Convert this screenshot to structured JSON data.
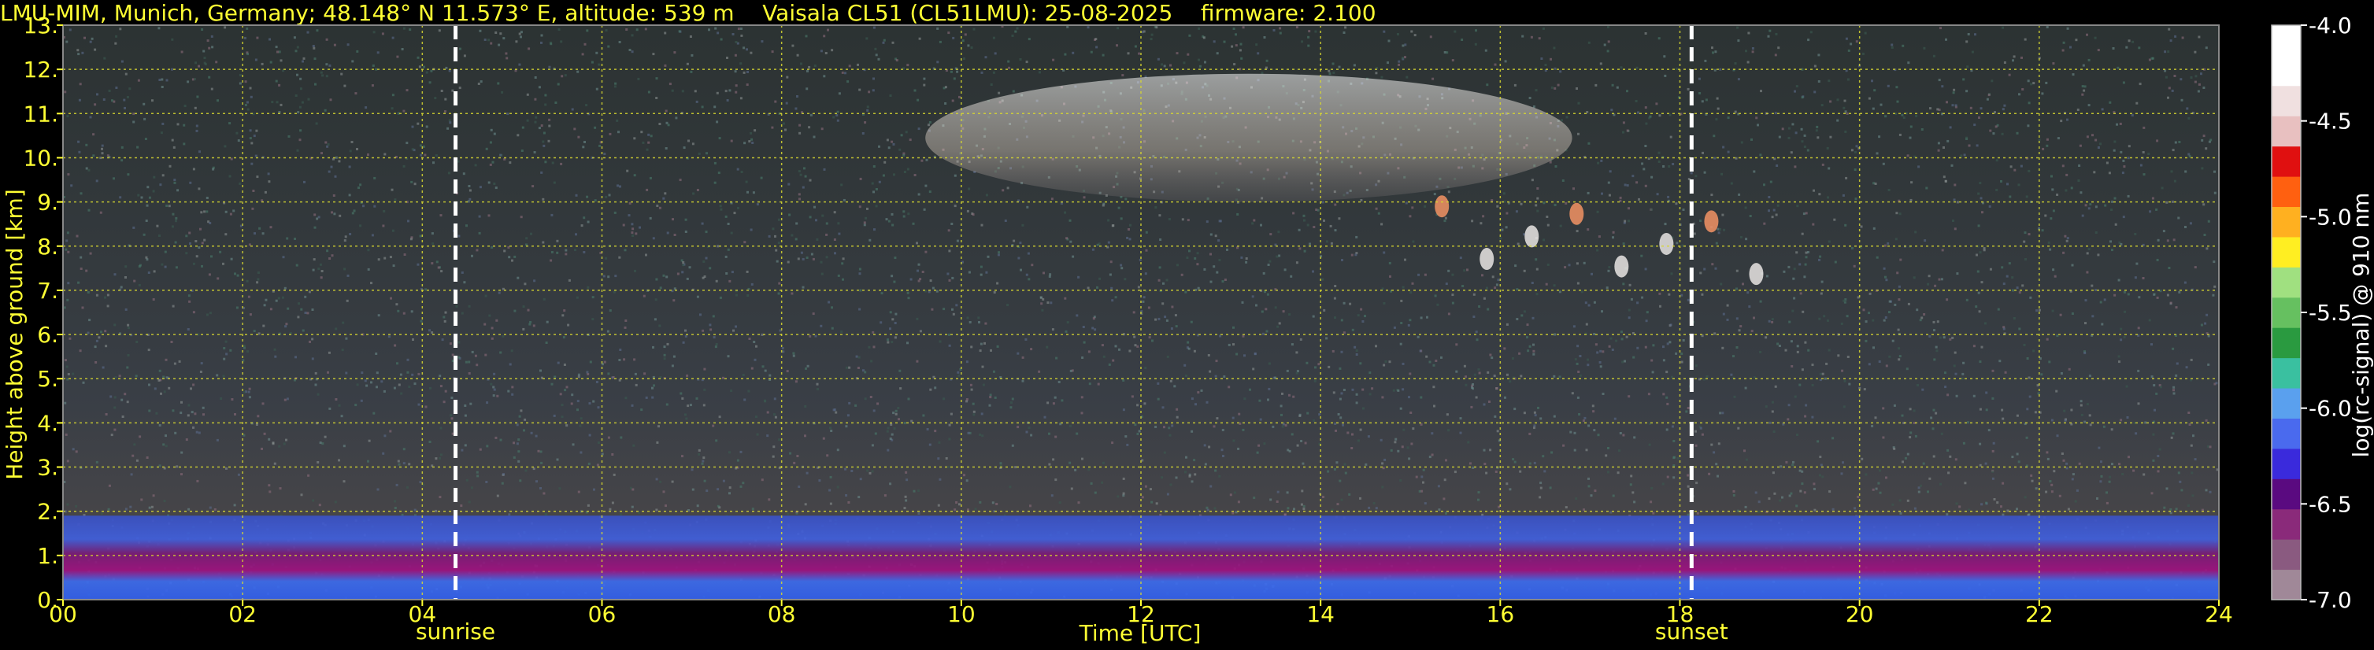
{
  "chart_data": {
    "type": "heatmap",
    "title": "LMU-MIM, Munich, Germany; 48.148° N 11.573° E, altitude: 539 m    Vaisala CL51 (CL51LMU): 25-08-2025    firmware: 2.100",
    "xlabel": "Time [UTC]",
    "ylabel": "Height above ground [km]",
    "xlim": [
      0,
      24
    ],
    "ylim": [
      0,
      13
    ],
    "xticks": [
      "00",
      "02",
      "04",
      "06",
      "08",
      "10",
      "12",
      "14",
      "16",
      "18",
      "20",
      "22",
      "24"
    ],
    "yticks": [
      "0.",
      "1.",
      "2.",
      "3.",
      "4.",
      "5.",
      "6.",
      "7.",
      "8.",
      "9.",
      "10.",
      "11.",
      "12.",
      "13."
    ],
    "grid": true,
    "markers": [
      {
        "label": "sunrise",
        "x": 4.37
      },
      {
        "label": "sunset",
        "x": 18.13
      }
    ],
    "colorbar": {
      "label": "log(rc-signal) @ 910 nm",
      "range": [
        -7.0,
        -4.0
      ],
      "ticks": [
        "-4.0",
        "-4.5",
        "-5.0",
        "-5.5",
        "-6.0",
        "-6.5",
        "-7.0"
      ]
    },
    "features": [
      {
        "name": "boundary layer aerosol",
        "x": [
          0,
          24
        ],
        "y": [
          0,
          1.9
        ]
      },
      {
        "name": "cirrus cloud",
        "x": [
          9.6,
          16.8
        ],
        "y": [
          9.0,
          11.9
        ]
      },
      {
        "name": "scattered cloud fragments",
        "x": [
          15.1,
          19.1
        ],
        "y": [
          7.2,
          8.9
        ]
      }
    ]
  },
  "colors": {
    "text_accent": "#ffff33",
    "grid": "#d8d830",
    "background": "#000000",
    "marker": "#ffffff"
  }
}
